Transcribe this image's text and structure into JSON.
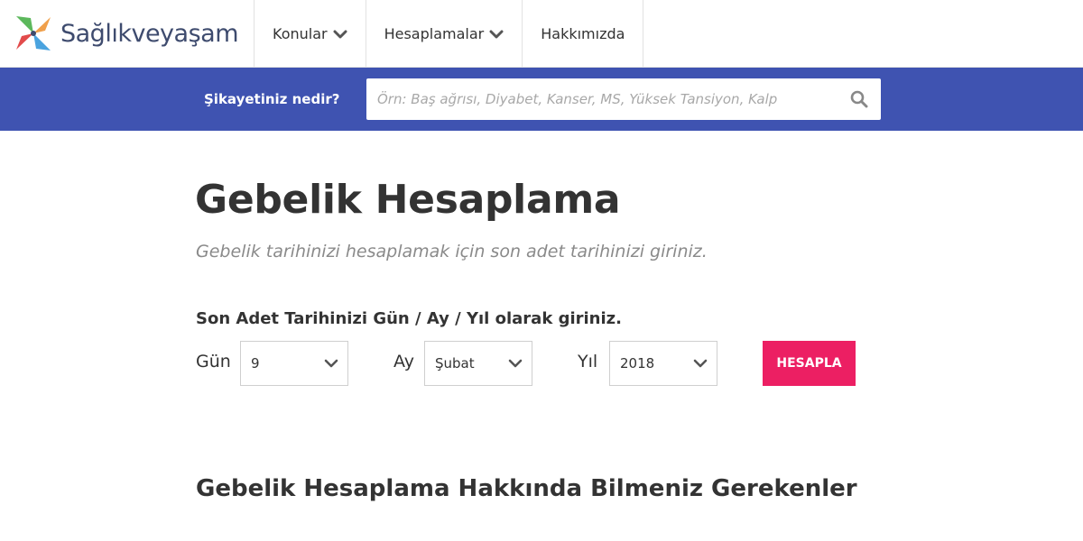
{
  "header": {
    "logo_text": "Sağlıkveyaşam",
    "nav": [
      {
        "label": "Konular",
        "has_dropdown": true
      },
      {
        "label": "Hesaplamalar",
        "has_dropdown": true
      },
      {
        "label": "Hakkımızda",
        "has_dropdown": false
      }
    ]
  },
  "search": {
    "label": "Şikayetiniz nedir?",
    "placeholder": "Örn: Baş ağrısı, Diyabet, Kanser, MS, Yüksek Tansiyon, Kalp",
    "icon": "search-icon"
  },
  "main": {
    "title": "Gebelik Hesaplama",
    "subtitle": "Gebelik tarihinizi hesaplamak için son adet tarihinizi giriniz.",
    "form": {
      "instruction": "Son Adet Tarihinizi Gün / Ay / Yıl olarak giriniz.",
      "day_label": "Gün",
      "day_value": "9",
      "month_label": "Ay",
      "month_value": "Şubat",
      "year_label": "Yıl",
      "year_value": "2018",
      "submit_label": "HESAPLA"
    },
    "section_title": "Gebelik Hesaplama Hakkında Bilmeniz Gerekenler"
  },
  "colors": {
    "brand_bar": "#3f53b1",
    "button": "#ec1f63",
    "logo_text": "#3e4b6e"
  }
}
